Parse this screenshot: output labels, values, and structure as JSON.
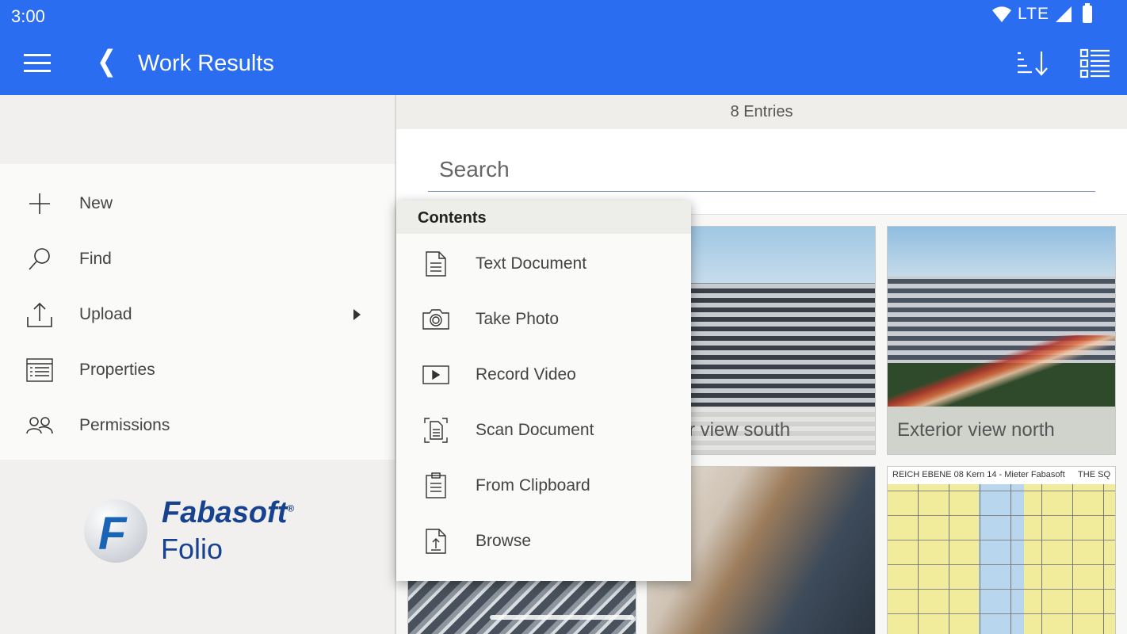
{
  "status_bar": {
    "time": "3:00",
    "network": "LTE"
  },
  "appbar": {
    "title": "Work Results",
    "color": "#2b6df0"
  },
  "side_menu": {
    "items": [
      {
        "label": "New",
        "icon": "plus-icon"
      },
      {
        "label": "Find",
        "icon": "search-icon"
      },
      {
        "label": "Upload",
        "icon": "upload-icon"
      },
      {
        "label": "Properties",
        "icon": "properties-icon"
      },
      {
        "label": "Permissions",
        "icon": "users-icon"
      }
    ]
  },
  "logo": {
    "letter": "F",
    "brand": "Fabasoft",
    "registered": "®",
    "product": "Folio"
  },
  "list": {
    "entries_text": "8 Entries",
    "search_placeholder": "Search",
    "cards": [
      {
        "caption": "erior view  south"
      },
      {
        "caption": "Exterior view north"
      },
      {
        "caption": ""
      },
      {
        "caption": ""
      },
      {
        "caption": ""
      }
    ],
    "plan_header": "REICH EBENE 08 Kern 14 - Mieter Fabasoft",
    "plan_header_right": "THE SQ"
  },
  "contents_popup": {
    "title": "Contents",
    "items": [
      {
        "label": "Text Document",
        "icon": "text-document-icon"
      },
      {
        "label": "Take Photo",
        "icon": "camera-icon"
      },
      {
        "label": "Record Video",
        "icon": "video-icon"
      },
      {
        "label": "Scan Document",
        "icon": "scan-document-icon"
      },
      {
        "label": "From Clipboard",
        "icon": "clipboard-icon"
      },
      {
        "label": "Browse",
        "icon": "browse-file-icon"
      }
    ]
  }
}
